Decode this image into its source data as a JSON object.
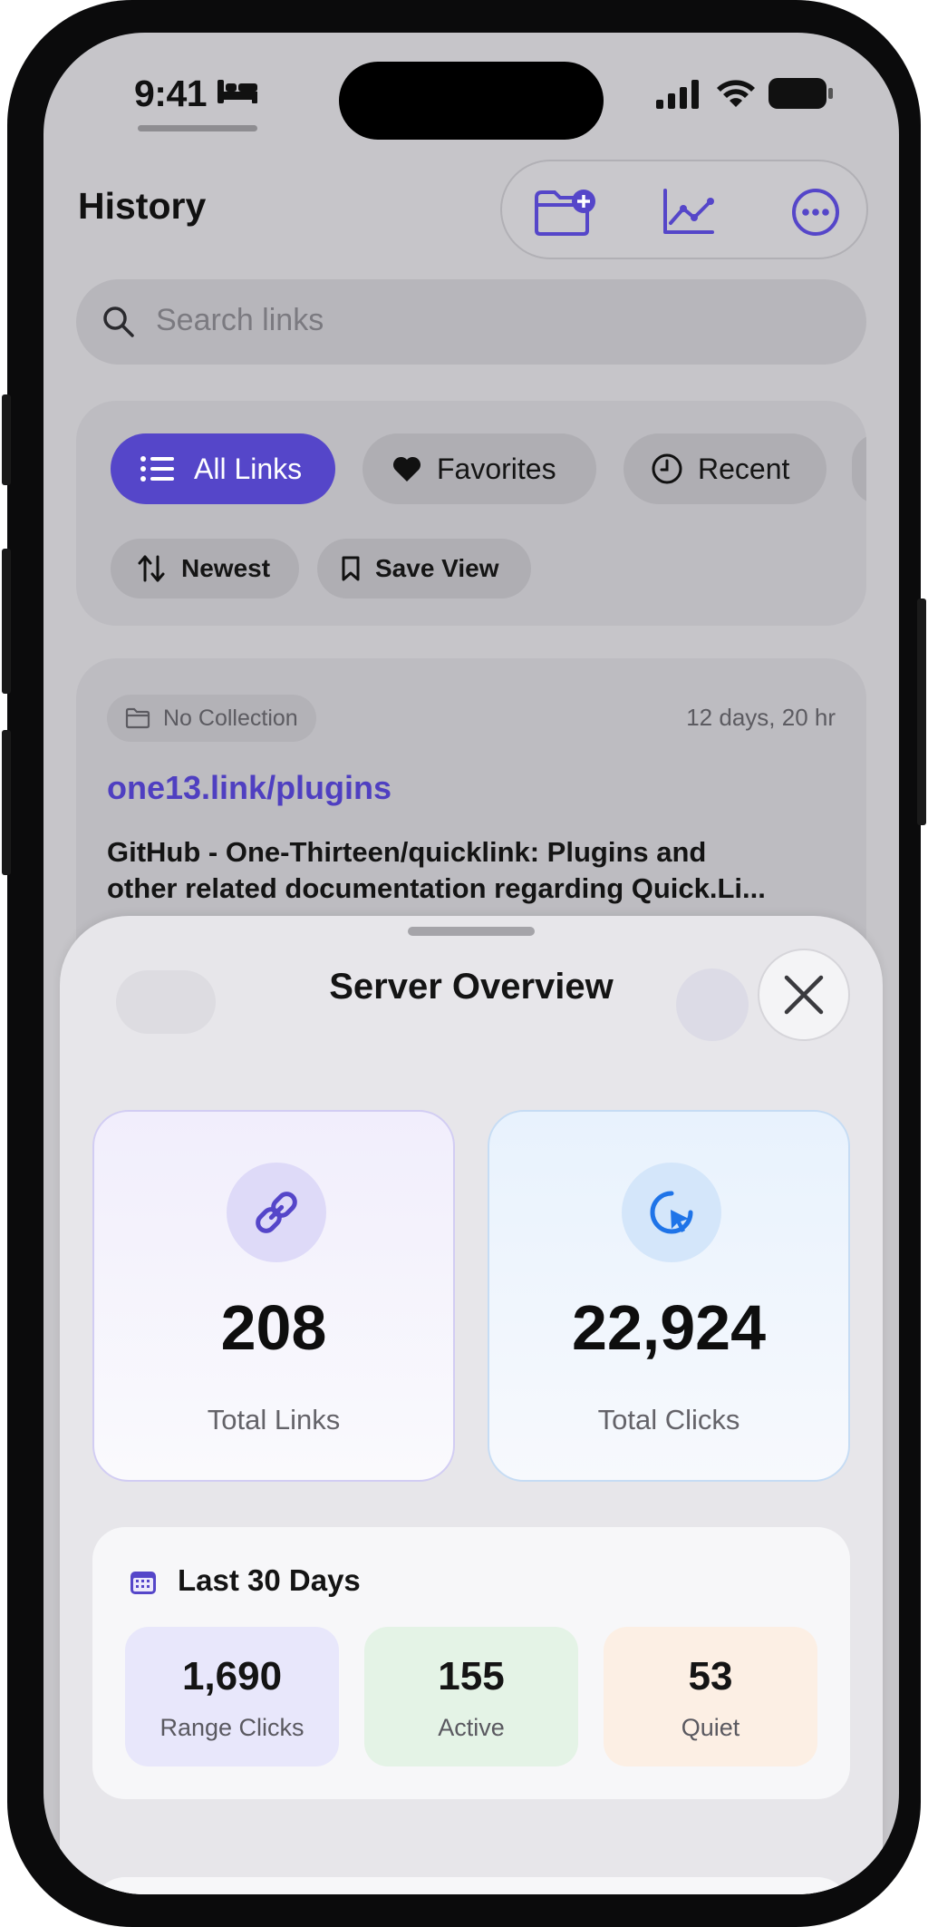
{
  "status_bar": {
    "time": "9:41"
  },
  "header": {
    "title": "History"
  },
  "search": {
    "placeholder": "Search links"
  },
  "filters": {
    "chips": [
      {
        "label": "All Links",
        "active": true
      },
      {
        "label": "Favorites"
      },
      {
        "label": "Recent"
      }
    ],
    "sort_label": "Newest",
    "save_view_label": "Save View"
  },
  "link_item": {
    "collection": "No Collection",
    "age": "12 days, 20 hr",
    "short_url": "one13.link/plugins",
    "title_line1": "GitHub - One-Thirteen/quicklink: Plugins and",
    "title_line2": "other related documentation regarding Quick.Li..."
  },
  "sheet": {
    "title": "Server Overview",
    "total_links": {
      "value": "208",
      "label": "Total Links"
    },
    "total_clicks": {
      "value": "22,924",
      "label": "Total Clicks"
    },
    "range": {
      "title": "Last 30 Days",
      "stats": [
        {
          "value": "1,690",
          "label": "Range Clicks",
          "color": "#e8e7fb"
        },
        {
          "value": "155",
          "label": "Active",
          "color": "#e4f3e6"
        },
        {
          "value": "53",
          "label": "Quiet",
          "color": "#fcefe4"
        }
      ]
    }
  },
  "colors": {
    "accent": "#5546c9",
    "link": "#4f3fc1",
    "blue_accent": "#1f74e8"
  }
}
